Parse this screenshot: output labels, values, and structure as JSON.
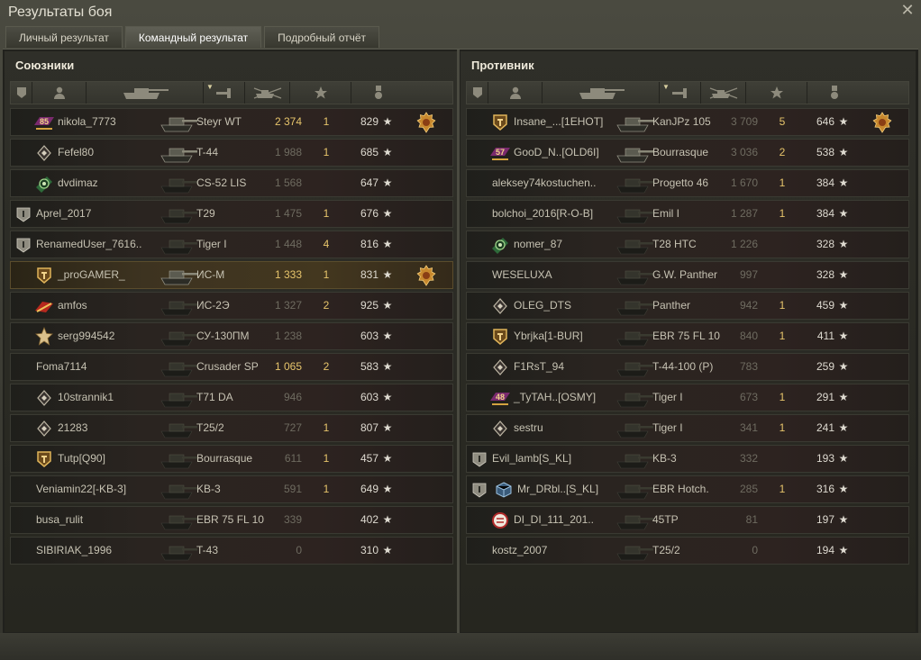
{
  "window": {
    "title": "Результаты боя",
    "close_icon": "✕"
  },
  "tabs": [
    {
      "label": "Личный результат",
      "active": false
    },
    {
      "label": "Командный результат",
      "active": true
    },
    {
      "label": "Подробный отчёт",
      "active": false
    }
  ],
  "allies": {
    "title": "Союзники",
    "rows": [
      {
        "badge": "85",
        "name": "nikola_7773",
        "vehicle": "Steyr WT",
        "damage": "2 374",
        "damage_gold": true,
        "kills": "1",
        "xp": "829",
        "medal": true,
        "highlight": false
      },
      {
        "badge": "diamond",
        "name": "Fefel80",
        "vehicle": "T-44",
        "damage": "1 988",
        "damage_gold": false,
        "kills": "1",
        "xp": "685",
        "medal": false,
        "highlight": false
      },
      {
        "badge": "green",
        "name": "dvdimaz",
        "vehicle": "CS-52 LIS",
        "damage": "1 568",
        "damage_gold": false,
        "kills": "",
        "xp": "647",
        "medal": false,
        "highlight": false
      },
      {
        "rank": true,
        "name": "Aprel_2017",
        "vehicle": "T29",
        "damage": "1 475",
        "damage_gold": false,
        "kills": "1",
        "xp": "676",
        "medal": false,
        "highlight": false
      },
      {
        "rank": true,
        "name": "RenamedUser_7616..",
        "vehicle": "Tiger I",
        "damage": "1 448",
        "damage_gold": false,
        "kills": "4",
        "xp": "816",
        "medal": false,
        "highlight": false
      },
      {
        "badge": "shield",
        "name": "_proGAMER_",
        "vehicle": "ИС-М",
        "damage": "1 333",
        "damage_gold": true,
        "kills": "1",
        "xp": "831",
        "medal": true,
        "highlight": true
      },
      {
        "badge": "flag",
        "name": "amfos",
        "vehicle": "ИС-2Э",
        "damage": "1 327",
        "damage_gold": false,
        "kills": "2",
        "xp": "925",
        "medal": false,
        "highlight": false
      },
      {
        "badge": "star",
        "name": "serg994542",
        "vehicle": "СУ-130ПМ",
        "damage": "1 238",
        "damage_gold": false,
        "kills": "",
        "xp": "603",
        "medal": false,
        "highlight": false
      },
      {
        "name": "Foma7114",
        "vehicle": "Crusader SP",
        "damage": "1 065",
        "damage_gold": true,
        "kills": "2",
        "xp": "583",
        "medal": false,
        "highlight": false
      },
      {
        "badge": "diamond",
        "name": "10strannik1",
        "vehicle": "T71 DA",
        "damage": "946",
        "damage_gold": false,
        "kills": "",
        "xp": "603",
        "medal": false,
        "highlight": false
      },
      {
        "badge": "diamond",
        "name": "21283",
        "vehicle": "T25/2",
        "damage": "727",
        "damage_gold": false,
        "kills": "1",
        "xp": "807",
        "medal": false,
        "highlight": false
      },
      {
        "badge": "shield",
        "name": "Tutp[Q90]",
        "vehicle": "Bourrasque",
        "damage": "611",
        "damage_gold": false,
        "kills": "1",
        "xp": "457",
        "medal": false,
        "highlight": false
      },
      {
        "name": "Veniamin22[-KB-3]",
        "vehicle": "KB-3",
        "damage": "591",
        "damage_gold": false,
        "kills": "1",
        "xp": "649",
        "medal": false,
        "highlight": false
      },
      {
        "name": "busa_rulit",
        "vehicle": "EBR 75 FL 10",
        "damage": "339",
        "damage_gold": false,
        "kills": "",
        "xp": "402",
        "medal": false,
        "highlight": false
      },
      {
        "name": "SIBIRIAK_1996",
        "vehicle": "T-43",
        "damage": "0",
        "damage_gold": false,
        "kills": "",
        "xp": "310",
        "medal": false,
        "highlight": false
      }
    ]
  },
  "enemies": {
    "title": "Противник",
    "rows": [
      {
        "badge": "shield",
        "name": "Insane_...[1EHOT]",
        "vehicle": "KanJPz 105",
        "damage": "3 709",
        "damage_gold": false,
        "kills": "5",
        "xp": "646",
        "medal": true,
        "highlight": false
      },
      {
        "badge": "57",
        "name": "GooD_N..[OLD6I]",
        "vehicle": "Bourrasque",
        "damage": "3 036",
        "damage_gold": false,
        "kills": "2",
        "xp": "538",
        "medal": false,
        "highlight": false
      },
      {
        "name": "aleksey74kostuchen..",
        "vehicle": "Progetto 46",
        "damage": "1 670",
        "damage_gold": false,
        "kills": "1",
        "xp": "384",
        "medal": false,
        "highlight": false
      },
      {
        "name": "bolchoi_2016[R-O-B]",
        "vehicle": "Emil I",
        "damage": "1 287",
        "damage_gold": false,
        "kills": "1",
        "xp": "384",
        "medal": false,
        "highlight": false
      },
      {
        "badge": "green",
        "name": "nomer_87",
        "vehicle": "T28 HTC",
        "damage": "1 226",
        "damage_gold": false,
        "kills": "",
        "xp": "328",
        "medal": false,
        "highlight": false
      },
      {
        "name": "WESELUXA",
        "vehicle": "G.W. Panther",
        "damage": "997",
        "damage_gold": false,
        "kills": "",
        "xp": "328",
        "medal": false,
        "highlight": false
      },
      {
        "badge": "diamond",
        "name": "OLEG_DTS",
        "vehicle": "Panther",
        "damage": "942",
        "damage_gold": false,
        "kills": "1",
        "xp": "459",
        "medal": false,
        "highlight": false
      },
      {
        "badge": "shield",
        "name": "Ybrjka[1-BUR]",
        "vehicle": "EBR 75 FL 10",
        "damage": "840",
        "damage_gold": false,
        "kills": "1",
        "xp": "411",
        "medal": false,
        "highlight": false
      },
      {
        "badge": "diamond",
        "name": "F1RsT_94",
        "vehicle": "T-44-100 (P)",
        "damage": "783",
        "damage_gold": false,
        "kills": "",
        "xp": "259",
        "medal": false,
        "highlight": false
      },
      {
        "badge": "48",
        "name": "_TyTAH..[OSMY]",
        "vehicle": "Tiger I",
        "damage": "673",
        "damage_gold": false,
        "kills": "1",
        "xp": "291",
        "medal": false,
        "highlight": false
      },
      {
        "badge": "diamond",
        "name": "sestru",
        "vehicle": "Tiger I",
        "damage": "341",
        "damage_gold": false,
        "kills": "1",
        "xp": "241",
        "medal": false,
        "highlight": false
      },
      {
        "rank": true,
        "name": "Evil_lamb[S_KL]",
        "vehicle": "KB-3",
        "damage": "332",
        "damage_gold": false,
        "kills": "",
        "xp": "193",
        "medal": false,
        "highlight": false
      },
      {
        "rank": true,
        "badge": "cube",
        "name": "Mr_DRbl..[S_KL]",
        "vehicle": "EBR Hotch.",
        "damage": "285",
        "damage_gold": false,
        "kills": "1",
        "xp": "316",
        "medal": false,
        "highlight": false
      },
      {
        "badge": "red",
        "name": "DI_DI_111_201..",
        "vehicle": "45TP",
        "damage": "81",
        "damage_gold": false,
        "kills": "",
        "xp": "197",
        "medal": false,
        "highlight": false
      },
      {
        "name": "kostz_2007",
        "vehicle": "T25/2",
        "damage": "0",
        "damage_gold": false,
        "kills": "",
        "xp": "194",
        "medal": false,
        "highlight": false
      }
    ]
  },
  "columns": [
    {
      "icon": "squad-icon"
    },
    {
      "icon": "player-icon"
    },
    {
      "icon": "tank-icon"
    },
    {
      "icon": "damage-icon",
      "sorted": true
    },
    {
      "icon": "kills-icon"
    },
    {
      "icon": "xp-star-icon"
    },
    {
      "icon": "medal-icon"
    }
  ],
  "star_glyph": "★"
}
